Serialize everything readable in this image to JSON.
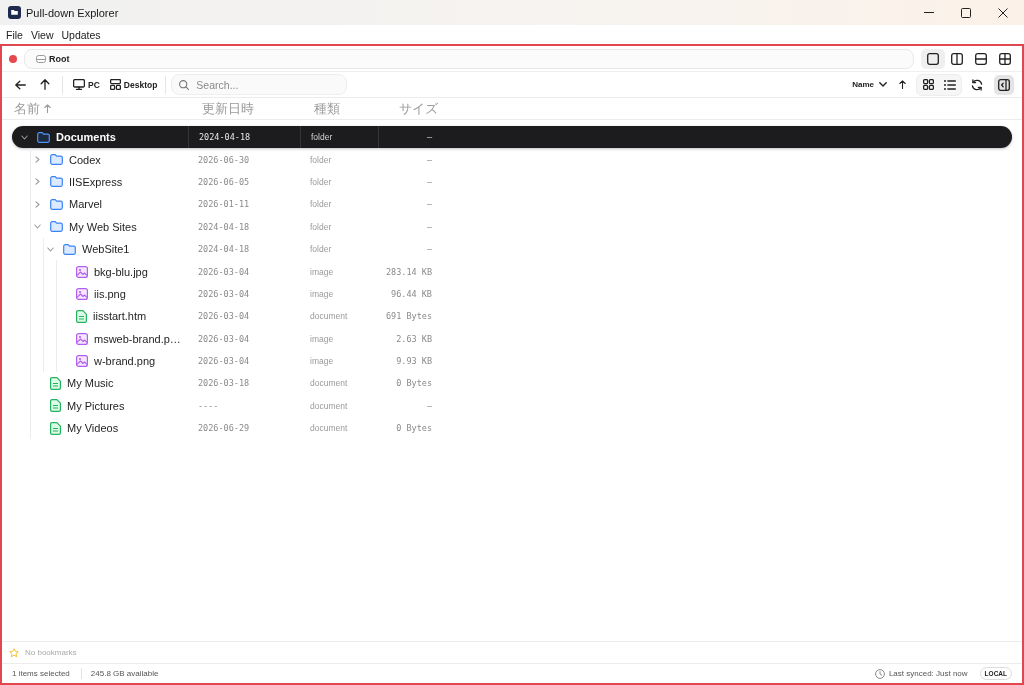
{
  "window": {
    "title": "Pull-down Explorer"
  },
  "menu": [
    {
      "label": "File"
    },
    {
      "label": "View"
    },
    {
      "label": "Updates"
    }
  ],
  "address_bar": {
    "crumbs": [
      "Root"
    ]
  },
  "layouts": [
    {
      "kind": "single",
      "selected": true
    },
    {
      "kind": "columns",
      "selected": false
    },
    {
      "kind": "rows",
      "selected": false
    },
    {
      "kind": "grid",
      "selected": false
    }
  ],
  "toolbar": {
    "locations": [
      {
        "kind": "pc",
        "label": "PC"
      },
      {
        "kind": "desktop",
        "label": "Desktop"
      }
    ],
    "search": {
      "placeholder": "Search..."
    },
    "sort": {
      "label": "Name"
    },
    "panel_toggle": {
      "on": true
    }
  },
  "columns": [
    {
      "label": "名前",
      "sorted": true
    },
    {
      "label": "更新日時",
      "sorted": false
    },
    {
      "label": "種類",
      "sorted": false
    },
    {
      "label": "サイズ",
      "sorted": false
    }
  ],
  "tree": [
    {
      "kind": "folder",
      "name": "Documents",
      "modified": "2024-04-18",
      "type": "folder",
      "size": "—",
      "expanded": true,
      "selected": true,
      "children": [
        {
          "kind": "folder",
          "name": "Codex",
          "modified": "2026-06-30",
          "type": "folder",
          "size": "—",
          "expanded": false,
          "selected": false
        },
        {
          "kind": "folder",
          "name": "IISExpress",
          "modified": "2026-06-05",
          "type": "folder",
          "size": "—",
          "expanded": false,
          "selected": false
        },
        {
          "kind": "folder",
          "name": "Marvel",
          "modified": "2026-01-11",
          "type": "folder",
          "size": "—",
          "expanded": false,
          "selected": false
        },
        {
          "kind": "folder",
          "name": "My Web Sites",
          "modified": "2024-04-18",
          "type": "folder",
          "size": "—",
          "expanded": true,
          "selected": false,
          "children": [
            {
              "kind": "folder",
              "name": "WebSite1",
              "modified": "2024-04-18",
              "type": "folder",
              "size": "—",
              "expanded": true,
              "selected": false,
              "children": [
                {
                  "kind": "image",
                  "name": "bkg-blu.jpg",
                  "modified": "2026-03-04",
                  "type": "image",
                  "size": "283.14 KB",
                  "selected": false
                },
                {
                  "kind": "image",
                  "name": "iis.png",
                  "modified": "2026-03-04",
                  "type": "image",
                  "size": "96.44 KB",
                  "selected": false
                },
                {
                  "kind": "document",
                  "name": "iisstart.htm",
                  "modified": "2026-03-04",
                  "type": "document",
                  "size": "691 Bytes",
                  "selected": false
                },
                {
                  "kind": "image",
                  "name": "msweb-brand.p…",
                  "modified": "2026-03-04",
                  "type": "image",
                  "size": "2.63 KB",
                  "selected": false
                },
                {
                  "kind": "image",
                  "name": "w-brand.png",
                  "modified": "2026-03-04",
                  "type": "image",
                  "size": "9.93 KB",
                  "selected": false
                }
              ]
            }
          ]
        },
        {
          "kind": "document",
          "name": "My Music",
          "modified": "2026-03-18",
          "type": "document",
          "size": "0 Bytes",
          "selected": false
        },
        {
          "kind": "document",
          "name": "My Pictures",
          "modified": "----",
          "type": "document",
          "size": "—",
          "selected": false
        },
        {
          "kind": "document",
          "name": "My Videos",
          "modified": "2026-06-29",
          "type": "document",
          "size": "0 Bytes",
          "selected": false
        }
      ]
    }
  ],
  "bookmarks": {
    "empty_text": "No bookmarks"
  },
  "status_bar": {
    "selection": "1 items selected",
    "free_space": "245.8 GB available",
    "sync": "Last synced: Just now",
    "mode": "LOCAL"
  }
}
